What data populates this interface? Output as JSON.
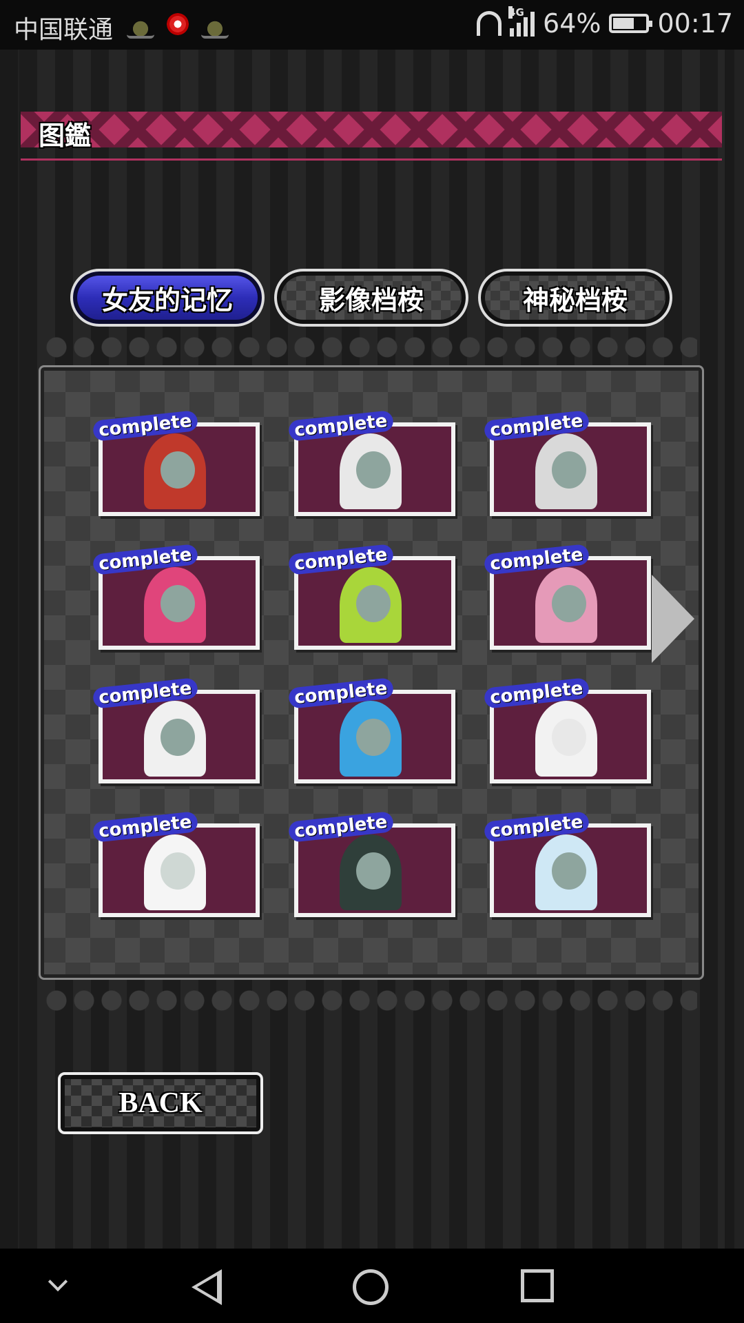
{
  "status_bar": {
    "carrier": "中国联通",
    "network": "4G",
    "battery_percent": "64%",
    "battery_level": 0.64,
    "time": "00:17",
    "icons": [
      "crown-icon",
      "app-ring-icon",
      "crown-icon",
      "headset-icon",
      "signal-icon",
      "battery-icon"
    ]
  },
  "header": {
    "title": "图鑑"
  },
  "tabs": [
    {
      "label": "女友的记忆",
      "active": true
    },
    {
      "label": "影像档桉",
      "active": false
    },
    {
      "label": "神秘档桉",
      "active": false
    }
  ],
  "gallery": {
    "cards": [
      {
        "badge": "complete",
        "hair": "#c0392b",
        "face": "#8ea59e"
      },
      {
        "badge": "complete",
        "hair": "#e8e8e8",
        "face": "#8ea59e"
      },
      {
        "badge": "complete",
        "hair": "#d9d9d9",
        "face": "#8ea59e"
      },
      {
        "badge": "complete",
        "hair": "#e0457b",
        "face": "#8ea59e"
      },
      {
        "badge": "complete",
        "hair": "#a9d63a",
        "face": "#8ea59e"
      },
      {
        "badge": "complete",
        "hair": "#e59ab8",
        "face": "#8ea59e"
      },
      {
        "badge": "complete",
        "hair": "#f0f0f0",
        "face": "#8ea59e"
      },
      {
        "badge": "complete",
        "hair": "#3aa3e0",
        "face": "#8ea59e"
      },
      {
        "badge": "complete",
        "hair": "#f2f2f2",
        "face": "#e8e8e8"
      },
      {
        "badge": "complete",
        "hair": "#f5f5f5",
        "face": "#cfd8d4"
      },
      {
        "badge": "complete",
        "hair": "#2f3f3a",
        "face": "#8ea59e"
      },
      {
        "badge": "complete",
        "hair": "#cfe8f5",
        "face": "#8ea59e"
      }
    ]
  },
  "back_button": {
    "label": "BACK"
  },
  "nav_bar": {
    "icons": [
      "chevron-down-icon",
      "back-icon",
      "home-icon",
      "recents-icon"
    ]
  },
  "colors": {
    "accent_pink": "#b0315f",
    "active_tab_blue": "#2d2db8",
    "card_bg": "#5e1f3e"
  }
}
